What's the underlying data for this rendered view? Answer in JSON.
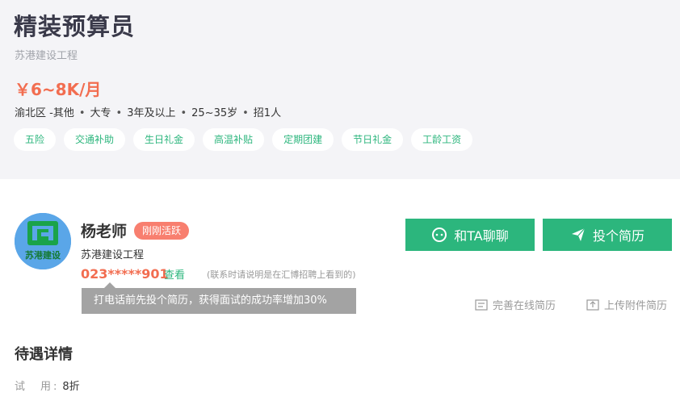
{
  "job": {
    "title": "精装预算员",
    "company": "苏港建设工程",
    "salary": "￥6~8K/月",
    "meta": [
      "渝北区 -其他",
      "大专",
      "3年及以上",
      "25~35岁",
      "招1人"
    ],
    "meta_separator": "•",
    "tags": [
      "五险",
      "交通补助",
      "生日礼金",
      "高温补贴",
      "定期团建",
      "节日礼金",
      "工龄工资"
    ]
  },
  "recruiter": {
    "name": "杨老师",
    "status_badge": "刚刚活跃",
    "company": "苏港建设工程",
    "phone": "023*****901",
    "view_label": "查看",
    "phone_note": "(联系时请说明是在汇博招聘上看到的)",
    "tooltip": "打电话前先投个简历，获得面试的成功率增加30%",
    "avatar_text": "苏港建设"
  },
  "actions": {
    "chat_label": "和TA聊聊",
    "resume_label": "投个简历",
    "online_resume_label": "完善在线简历",
    "upload_resume_label": "上传附件简历"
  },
  "benefits_section": {
    "title": "待遇详情",
    "rows": [
      {
        "key": "试　用:",
        "value": "8折"
      }
    ]
  },
  "colors": {
    "accent_green": "#2cb67d",
    "salary_orange": "#f26d50",
    "badge_red": "#f87f6f",
    "header_bg": "#f4f4f7"
  }
}
